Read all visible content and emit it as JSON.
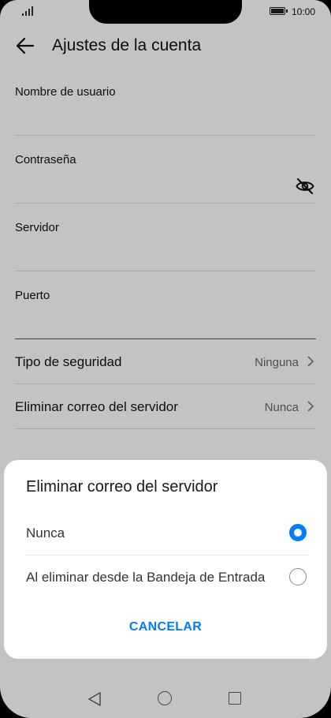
{
  "status_bar": {
    "time": "10:00"
  },
  "header": {
    "title": "Ajustes de la cuenta"
  },
  "fields": [
    {
      "label": "Nombre de usuario"
    },
    {
      "label": "Contraseña"
    },
    {
      "label": "Servidor"
    },
    {
      "label": "Puerto"
    }
  ],
  "settings": [
    {
      "label": "Tipo de seguridad",
      "value": "Ninguna"
    },
    {
      "label": "Eliminar correo del servidor",
      "value": "Nunca"
    }
  ],
  "dialog": {
    "title": "Eliminar correo del servidor",
    "options": [
      {
        "label": "Nunca",
        "selected": true
      },
      {
        "label": "Al eliminar desde la Bandeja de Entrada",
        "selected": false
      }
    ],
    "cancel_label": "CANCELAR"
  },
  "colors": {
    "accent": "#007dff"
  },
  "icons": [
    "signal-icon",
    "battery-icon",
    "back-arrow-icon",
    "eye-off-icon",
    "chevron-right-icon",
    "nav-back-icon",
    "nav-home-icon",
    "nav-recent-icon"
  ]
}
